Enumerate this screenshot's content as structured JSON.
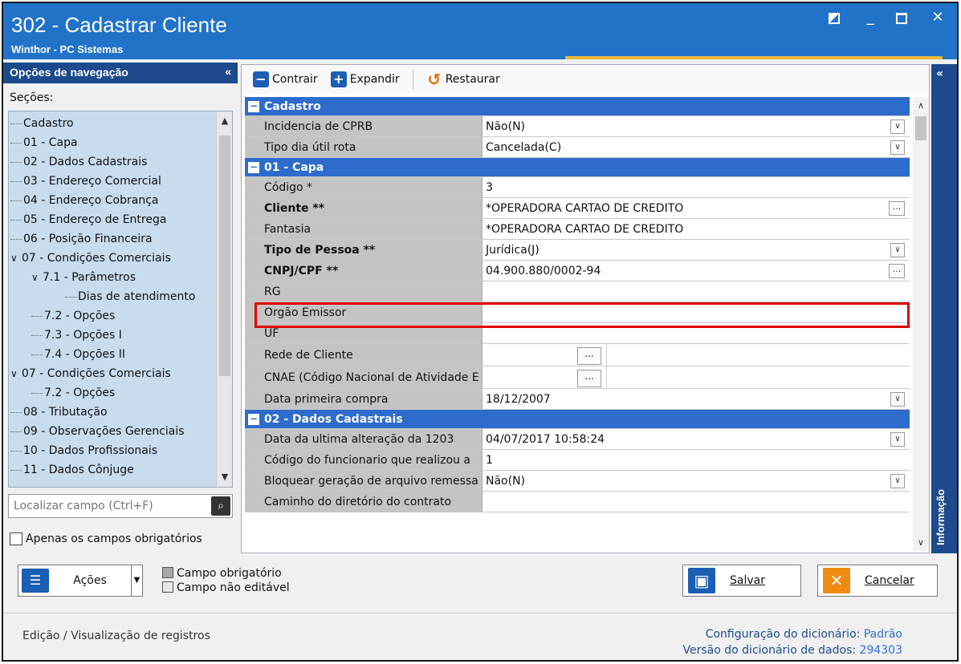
{
  "window": {
    "title": "302 - Cadastrar Cliente",
    "subtitle": "Winthor - PC Sistemas",
    "controls": {
      "minimize": "_",
      "close": "✕"
    }
  },
  "nav": {
    "heading": "Opções de navegação",
    "collapse": "«",
    "sections_label": "Seções:",
    "items": [
      {
        "label": "Cadastro",
        "level": 0,
        "expander": ""
      },
      {
        "label": "01 - Capa",
        "level": 0,
        "expander": ""
      },
      {
        "label": "02 - Dados Cadastrais",
        "level": 0,
        "expander": ""
      },
      {
        "label": "03 - Endereço Comercial",
        "level": 0,
        "expander": ""
      },
      {
        "label": "04 - Endereço Cobrança",
        "level": 0,
        "expander": ""
      },
      {
        "label": "05 - Endereço de Entrega",
        "level": 0,
        "expander": ""
      },
      {
        "label": "06 - Posição Financeira",
        "level": 0,
        "expander": ""
      },
      {
        "label": "07 - Condições Comerciais",
        "level": 0,
        "expander": "∨"
      },
      {
        "label": "7.1 - Parâmetros",
        "level": 1,
        "expander": "∨"
      },
      {
        "label": "Dias de atendimento",
        "level": 2,
        "expander": ""
      },
      {
        "label": "7.2 - Opções",
        "level": 1,
        "expander": ""
      },
      {
        "label": "7.3 - Opções I",
        "level": 1,
        "expander": ""
      },
      {
        "label": "7.4 - Opções II",
        "level": 1,
        "expander": ""
      },
      {
        "label": "07 - Condições Comerciais",
        "level": 0,
        "expander": "∨"
      },
      {
        "label": "7.2 - Opções",
        "level": 1,
        "expander": ""
      },
      {
        "label": "08 - Tributação",
        "level": 0,
        "expander": ""
      },
      {
        "label": "09 - Observações Gerenciais",
        "level": 0,
        "expander": ""
      },
      {
        "label": "10 - Dados Profissionais",
        "level": 0,
        "expander": ""
      },
      {
        "label": "11 - Dados Cônjuge",
        "level": 0,
        "expander": ""
      }
    ],
    "search_placeholder": "Localizar campo (Ctrl+F)",
    "only_required_label": "Apenas os campos obrigatórios"
  },
  "toolbar": {
    "contrair": "Contrair",
    "expandir": "Expandir",
    "restaurar": "Restaurar"
  },
  "grid": {
    "sections": [
      {
        "title": "Cadastro",
        "toggle": "−"
      },
      {
        "title": "01 - Capa",
        "toggle": "−"
      },
      {
        "title": "02 - Dados Cadastrais",
        "toggle": "−"
      }
    ],
    "rows": [
      {
        "label": "Incidencia de CPRB",
        "value": "Não(N)"
      },
      {
        "label": "Tipo dia útil rota",
        "value": "Cancelada(C)"
      },
      {
        "label": "Código *",
        "value": "3"
      },
      {
        "label": "Cliente **",
        "value": "*OPERADORA CARTAO DE CREDITO"
      },
      {
        "label": "Fantasia",
        "value": "*OPERADORA CARTAO DE CREDITO"
      },
      {
        "label": "Tipo de Pessoa **",
        "value": "Jurídica(J)"
      },
      {
        "label": "CNPJ/CPF **",
        "value": "04.900.880/0002-94"
      },
      {
        "label": "RG",
        "value": ""
      },
      {
        "label": "Orgão Emissor",
        "value": ""
      },
      {
        "label": "UF",
        "value": ""
      },
      {
        "label": "Rede de Cliente",
        "value": ""
      },
      {
        "label": "CNAE (Código Nacional de Atividade E",
        "value": ""
      },
      {
        "label": "Data primeira compra",
        "value": "18/12/2007"
      },
      {
        "label": "Data da ultima alteração da 1203",
        "value": "04/07/2017 10:58:24"
      },
      {
        "label": "Código do funcionario que realizou a",
        "value": "1"
      },
      {
        "label": "Bloquear geração de arquivo remessa",
        "value": "Não(N)"
      },
      {
        "label": "Caminho do diretório do contrato",
        "value": ""
      }
    ],
    "ellipsis": "...",
    "dropdown": "∨"
  },
  "info": {
    "label": "Informação",
    "collapse": "«"
  },
  "bottom": {
    "acoes": "Ações",
    "legend_required": "Campo obrigatório",
    "legend_noneditable": "Campo não editável",
    "salvar": "Salvar",
    "cancelar": "Cancelar"
  },
  "status": {
    "left": "Edição / Visualização de registros",
    "dict_config_label": "Configuração do dicionário:",
    "dict_config_value": "Padrão",
    "dict_version_label": "Versão do dicionário de dados:",
    "dict_version_value": "294303"
  },
  "colors": {
    "accent": "#2173c9",
    "section": "#2d6bcc",
    "highlight": "#e00000"
  }
}
